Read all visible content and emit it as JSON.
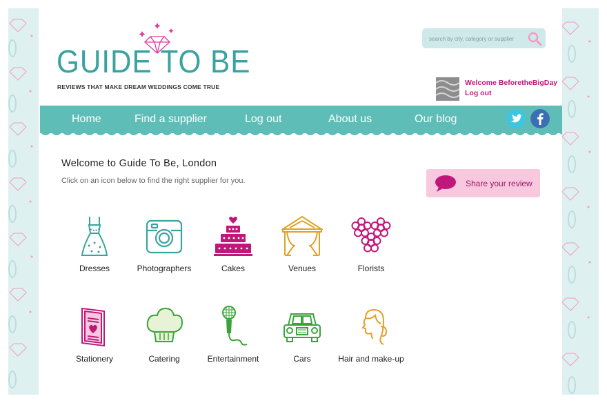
{
  "header": {
    "logo_title": "GUIDE TO BE",
    "tagline": "REVIEWS THAT MAKE DREAM WEDDINGS COME TRUE",
    "search_placeholder": "search by city, category or supplier"
  },
  "user": {
    "welcome": "Welcome BeforetheBigDay",
    "logout": "Log out"
  },
  "nav": {
    "items": [
      "Home",
      "Find a supplier",
      "Log out",
      "About us",
      "Our blog"
    ],
    "social": [
      "twitter-icon",
      "facebook-icon"
    ]
  },
  "main": {
    "title": "Welcome to Guide To Be, London",
    "subtitle": "Click on an icon below to find the right supplier for you.",
    "share_label": "Share your review",
    "categories": [
      {
        "label": "Dresses",
        "icon": "dress-icon",
        "color": "#3aa3a0"
      },
      {
        "label": "Photographers",
        "icon": "camera-icon",
        "color": "#3aa3a0"
      },
      {
        "label": "Cakes",
        "icon": "cake-icon",
        "color": "#c0187a"
      },
      {
        "label": "Venues",
        "icon": "gazebo-icon",
        "color": "#e0a126"
      },
      {
        "label": "Florists",
        "icon": "flowers-icon",
        "color": "#c0187a"
      },
      {
        "label": "Stationery",
        "icon": "card-icon",
        "color": "#c0187a"
      },
      {
        "label": "Catering",
        "icon": "chef-hat-icon",
        "color": "#3aa33a"
      },
      {
        "label": "Entertainment",
        "icon": "microphone-icon",
        "color": "#3aa33a"
      },
      {
        "label": "Cars",
        "icon": "car-icon",
        "color": "#3aa33a"
      },
      {
        "label": "Hair and make-up",
        "icon": "hair-icon",
        "color": "#e0a126"
      }
    ]
  },
  "colors": {
    "teal": "#5fbdb7",
    "pink": "#c0187a",
    "share_bg": "#f8c8df"
  }
}
